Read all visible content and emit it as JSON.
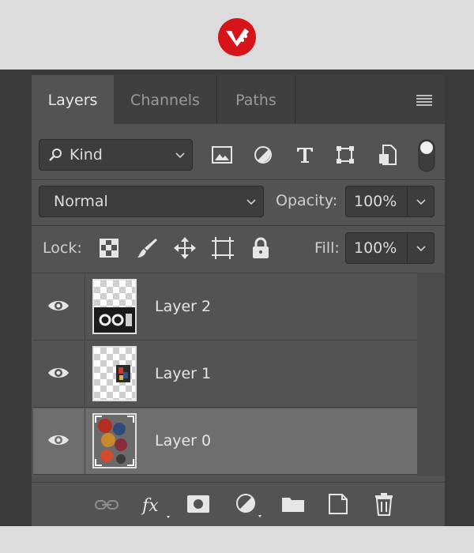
{
  "tabs": [
    {
      "label": "Layers",
      "active": true
    },
    {
      "label": "Channels",
      "active": false
    },
    {
      "label": "Paths",
      "active": false
    }
  ],
  "filter": {
    "kind_label": "Kind"
  },
  "blend": {
    "mode": "Normal",
    "opacity_label": "Opacity:",
    "opacity_value": "100%"
  },
  "lock": {
    "label": "Lock:",
    "fill_label": "Fill:",
    "fill_value": "100%"
  },
  "layers": [
    {
      "name": "Layer 2",
      "visible": true,
      "selected": false
    },
    {
      "name": "Layer 1",
      "visible": true,
      "selected": false
    },
    {
      "name": "Layer 0",
      "visible": true,
      "selected": true
    }
  ],
  "footer_icons": [
    "link-icon",
    "fx-icon",
    "mask-icon",
    "adjustment-icon",
    "folder-icon",
    "new-layer-icon",
    "trash-icon"
  ],
  "colors": {
    "accent": "#e2231a",
    "panel": "#535353",
    "selected_row": "#6e6e6e"
  }
}
